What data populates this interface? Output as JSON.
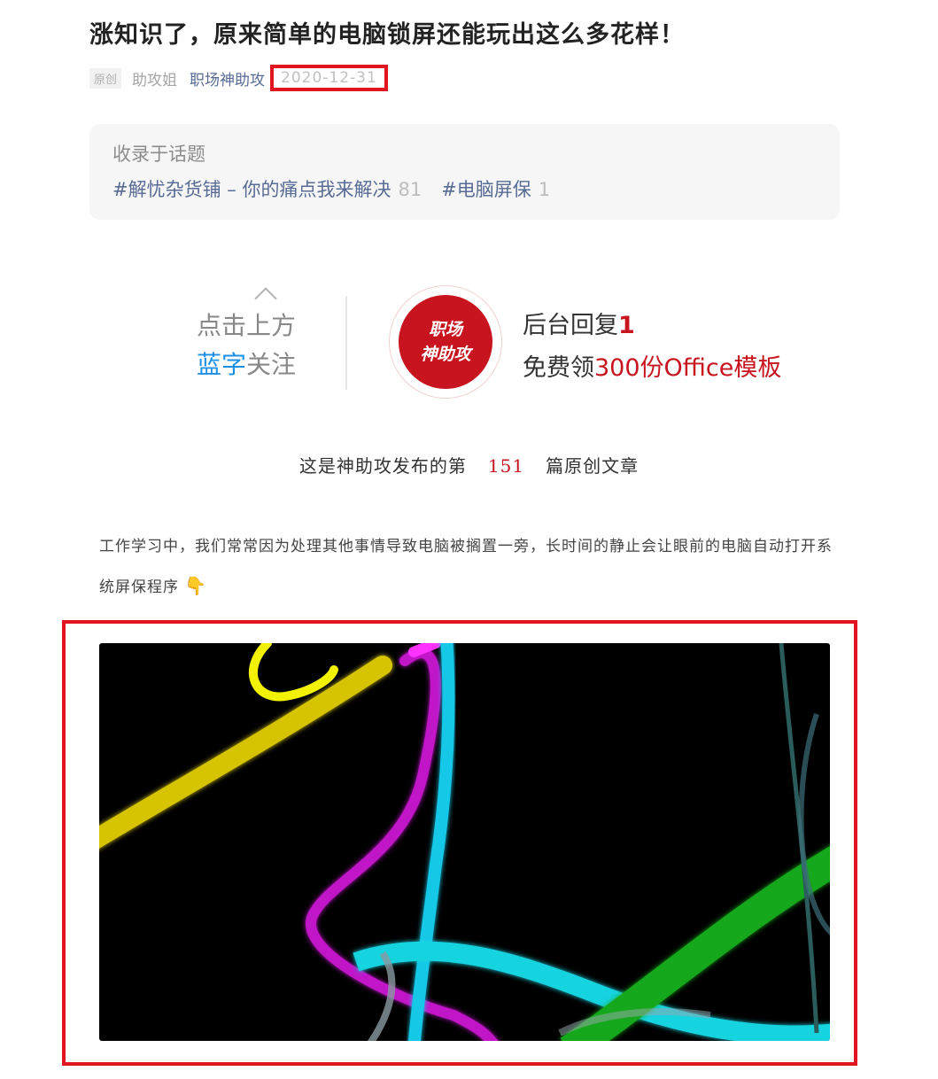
{
  "article": {
    "title": "涨知识了，原来简单的电脑锁屏还能玩出这么多花样！",
    "original_badge": "原创",
    "author": "助攻姐",
    "account": "职场神助攻",
    "date": "2020-12-31"
  },
  "topics": {
    "label": "收录于话题",
    "items": [
      {
        "name": "#解忧杂货铺 – 你的痛点我来解决",
        "count": "81"
      },
      {
        "name": "#电脑屏保",
        "count": "1"
      }
    ]
  },
  "follow_banner": {
    "line1": "点击上方",
    "line2_blue": "蓝字",
    "line2_rest": "关注",
    "logo_line1": "职场",
    "logo_line2": "神助攻",
    "reply_text": "后台回复",
    "reply_num": "1",
    "offer_prefix": "免费领",
    "offer_highlight": "300份Office模板"
  },
  "count_line": {
    "prefix": "这是神助攻发布的第",
    "number": "151",
    "suffix": "篇原创文章"
  },
  "body": {
    "paragraph": "工作学习中，我们常常因为处理其他事情导致电脑被搁置一旁，长时间的静止会让眼前的电脑自动打开系统屏保程序",
    "emoji": "👇"
  },
  "colors": {
    "highlight_border": "#e0151f",
    "link": "#576b95",
    "brand_red": "#c8141e",
    "accent_blue": "#1c90e6"
  }
}
